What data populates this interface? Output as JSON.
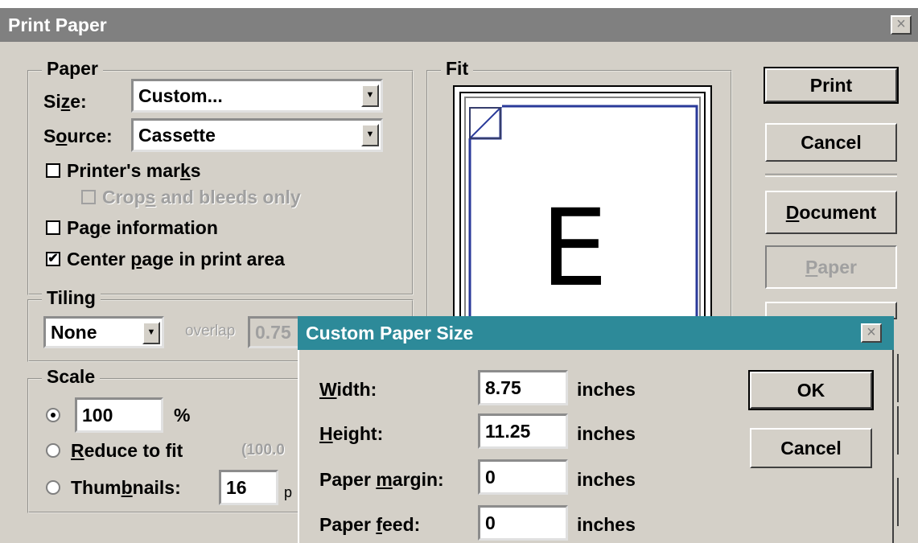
{
  "main_dialog": {
    "title": "Print Paper",
    "close_label": "×",
    "paper_group": {
      "legend": "Paper",
      "size_label_pre": "Si",
      "size_label_key": "z",
      "size_label_post": "e:",
      "size_value": "Custom...",
      "source_label_pre": "S",
      "source_label_key": "o",
      "source_label_post": "urce:",
      "source_value": "Cassette",
      "printers_marks_pre": "Printer's mar",
      "printers_marks_key": "k",
      "printers_marks_post": "s",
      "crops_pre": "Crop",
      "crops_key": "s",
      "crops_post": " and bleeds only",
      "page_info_pre": "Pa",
      "page_info_key": "g",
      "page_info_post": "e information",
      "center_pre": "Center ",
      "center_key": "p",
      "center_post": "age in print area",
      "check_mark": "✔"
    },
    "tiling_group": {
      "legend": "Tiling",
      "value": "None",
      "overlap_label": "overlap",
      "overlap_value": "0.75"
    },
    "scale_group": {
      "legend": "Scale",
      "percent_value": "100",
      "percent_sign": "%",
      "reduce_key": "R",
      "reduce_post": "educe to fit",
      "reduce_value": "(100.0",
      "thumb_pre": "Thum",
      "thumb_key": "b",
      "thumb_post": "nails:",
      "thumb_value": "16",
      "thumb_suffix": "p"
    },
    "fit_group": {
      "legend": "Fit",
      "page_glyph": "E"
    },
    "buttons": {
      "print": "Print",
      "cancel": "Cancel",
      "document_key": "D",
      "document_post": "ocument",
      "paper_key": "P",
      "paper_post": "aper"
    }
  },
  "custom_dialog": {
    "title": "Custom Paper Size",
    "close_label": "×",
    "width_key": "W",
    "width_post": "idth:",
    "width_value": "8.75",
    "height_key": "H",
    "height_post": "eight:",
    "height_value": "11.25",
    "margin_pre": "Paper ",
    "margin_key": "m",
    "margin_post": "argin:",
    "margin_value": "0",
    "feed_pre": "Paper ",
    "feed_key": "f",
    "feed_post": "eed:",
    "feed_value": "0",
    "unit": "inches",
    "ok": "OK",
    "cancel": "Cancel"
  },
  "colors": {
    "inactive_title": "#808080",
    "active_title": "#2d8a99",
    "face": "#d4d0c8",
    "preview_outline": "#2a3a9a"
  }
}
